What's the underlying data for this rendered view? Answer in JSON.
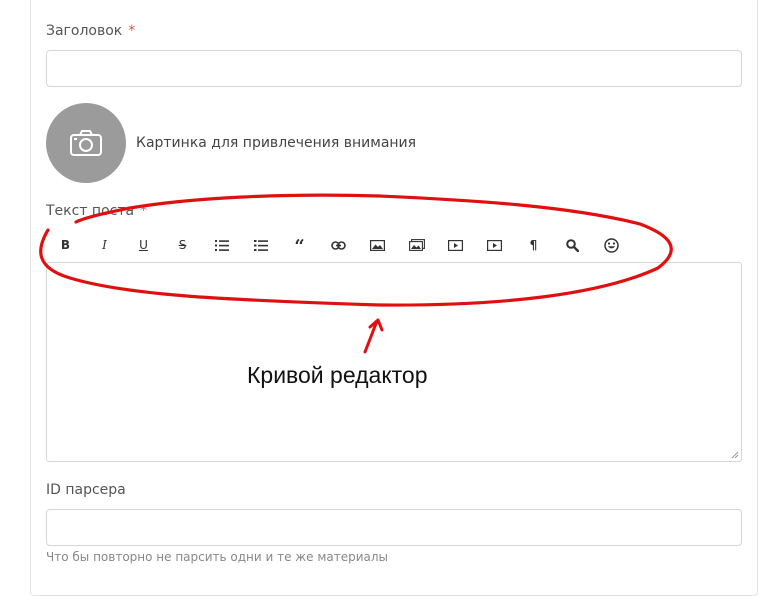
{
  "form": {
    "title_label": "Заголовок",
    "required_mark": "*",
    "title_value": "",
    "image_label": "Картинка для привлечения внимания",
    "text_label": "Текст поста",
    "parser_label": "ID парсера",
    "parser_value": "",
    "help_text": "Что бы повторно не парсить одни и те же материалы"
  },
  "toolbar": {
    "buttons": [
      {
        "name": "bold",
        "label": "B"
      },
      {
        "name": "italic",
        "label": "I"
      },
      {
        "name": "underline",
        "label": "U"
      },
      {
        "name": "strikethrough",
        "label": "S"
      },
      {
        "name": "unordered-list",
        "icon": "bullet-list-icon"
      },
      {
        "name": "ordered-list",
        "icon": "numbered-list-icon"
      },
      {
        "name": "quote",
        "label": "“"
      },
      {
        "name": "link",
        "icon": "link-icon"
      },
      {
        "name": "image",
        "icon": "image-icon"
      },
      {
        "name": "gallery",
        "icon": "gallery-icon"
      },
      {
        "name": "video",
        "icon": "video-icon"
      },
      {
        "name": "embed",
        "icon": "video-icon"
      },
      {
        "name": "paragraph",
        "label": "¶"
      },
      {
        "name": "search",
        "icon": "search-icon"
      },
      {
        "name": "emoji",
        "icon": "smiley-icon"
      }
    ]
  },
  "annotation": {
    "text": "Кривой редактор",
    "color": "#e01010"
  }
}
